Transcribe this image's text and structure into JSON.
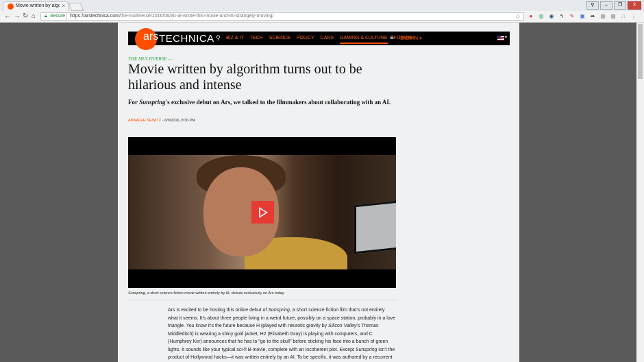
{
  "browser": {
    "tab_title": "Movie written by algorit",
    "tab_close": "×",
    "window_buttons": [
      "⚲",
      "–",
      "❐",
      "✕"
    ],
    "nav_buttons": [
      "←",
      "→",
      "↻",
      "⌂"
    ],
    "secure_label": "Secure",
    "url_domain": "https://arstechnica.com",
    "url_path": "/the-multiverse/2016/06/an-ai-wrote-this-movie-and-its-strangely-moving/",
    "bookmark_icon": "☆",
    "extensions": [
      {
        "icon": "adblock-icon",
        "glyph": "●",
        "color": "#d33"
      },
      {
        "icon": "globe-icon",
        "glyph": "◍",
        "color": "#3a7"
      },
      {
        "icon": "shield-icon",
        "glyph": "◉",
        "color": "#357"
      },
      {
        "icon": "lightning-icon",
        "glyph": "ϟ",
        "color": "#333"
      },
      {
        "icon": "pen-icon",
        "glyph": "✎",
        "color": "#c33"
      },
      {
        "icon": "window-icon",
        "glyph": "▣",
        "color": "#4a7ad6"
      },
      {
        "icon": "share-icon",
        "glyph": "➦",
        "color": "#333"
      },
      {
        "icon": "tile-icon",
        "glyph": "▦",
        "color": "#999"
      },
      {
        "icon": "tile2-icon",
        "glyph": "▦",
        "color": "#999"
      },
      {
        "icon": "cast-icon",
        "glyph": "⎍",
        "color": "#999"
      },
      {
        "icon": "menu-dots-icon",
        "glyph": "⋮",
        "color": "#555"
      }
    ]
  },
  "site": {
    "logo_ars": "ars",
    "logo_technica": "TECHNICA",
    "search_icon": "⚲",
    "nav": [
      "BIZ & IT",
      "TECH",
      "SCIENCE",
      "POLICY",
      "CARS",
      "GAMING & CULTURE",
      "FORUMS"
    ],
    "nav_active_index": 5,
    "menu_icon": "≡",
    "sign_in": "SIGN IN ▾",
    "flag_caret": "▾"
  },
  "article": {
    "kicker": "THE MULTIVERSE —",
    "headline": "Movie written by algorithm turns out to be hilarious and intense",
    "dek_pre": "For ",
    "dek_em": "Sunspring",
    "dek_post": "'s exclusive debut on Ars, we talked to the filmmakers about collaborating with an AI.",
    "author": "ANNALEE NEWITZ",
    "date": " - 6/9/2016, 8:30 PM",
    "caption_em": "Sunspring",
    "caption": ", a short science fiction movie written entirely by AI, debuts exclusively on Ars today.",
    "body_parts": [
      [
        "",
        "Ars is excited to be hosting this online debut of "
      ],
      [
        "em",
        "Sunspring"
      ],
      [
        "",
        ", a short science fiction film that's not entirely what it seems. It's about three people living in a weird future, possibly on a space station, probably in a love triangle. You know it's the future because H (played with neurotic gravity by "
      ],
      [
        "em",
        "Silicon Valley"
      ],
      [
        "",
        "'s Thomas Middleditch) is wearing a shiny gold jacket, H2 (Elisabeth Gray) is playing with computers, and C (Humphrey Ker) announces that he has to \"go to the skull\" before sticking his face into a bunch of green lights. It sounds like your typical sci-fi B-movie, complete with an incoherent plot. Except "
      ],
      [
        "em",
        "Sunspring"
      ],
      [
        "",
        " isn't the product of Hollywood hacks—it was written entirely by an AI. To be specific, it was authored by a recurrent neural network called long short-term memory."
      ]
    ]
  }
}
